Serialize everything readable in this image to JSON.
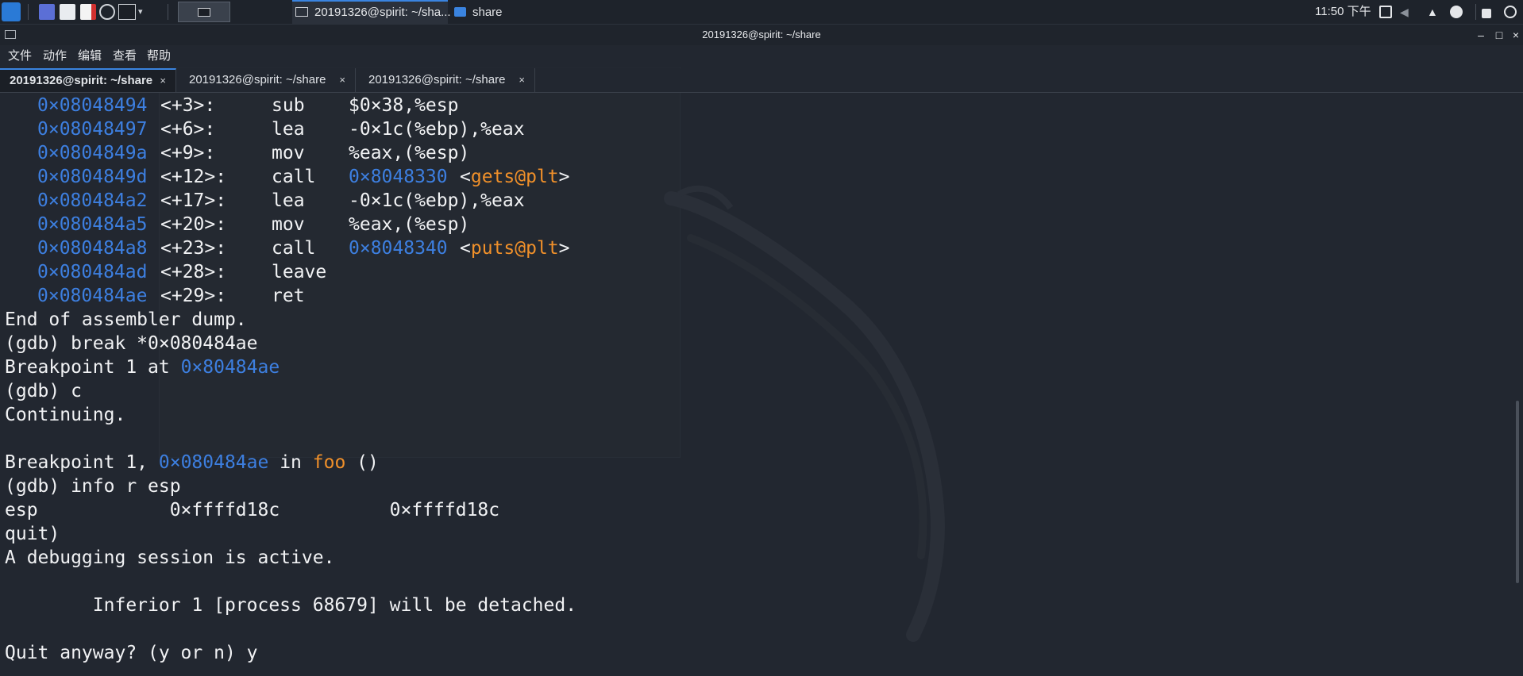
{
  "taskbar": {
    "task_terminal": "20191326@spirit: ~/sha...",
    "task_folder": "share",
    "clock": "11:50 下午"
  },
  "window": {
    "title": "20191326@spirit: ~/share",
    "btn_min": "–",
    "btn_max": "□",
    "btn_close": "×"
  },
  "menu": [
    "文件",
    "动作",
    "编辑",
    "查看",
    "帮助"
  ],
  "tabs": [
    {
      "label": "20191326@spirit: ~/share",
      "close": "×",
      "active": true
    },
    {
      "label": "20191326@spirit: ~/share",
      "close": "×",
      "active": false
    },
    {
      "label": "20191326@spirit: ~/share",
      "close": "×",
      "active": false
    }
  ],
  "terminal": {
    "asm": [
      {
        "addr": "0×08048494",
        "off": "<+3>:",
        "op": "sub",
        "args": "$0×38,%esp"
      },
      {
        "addr": "0×08048497",
        "off": "<+6>:",
        "op": "lea",
        "args": "-0×1c(%ebp),%eax"
      },
      {
        "addr": "0×0804849a",
        "off": "<+9>:",
        "op": "mov",
        "args": "%eax,(%esp)"
      },
      {
        "addr": "0×0804849d",
        "off": "<+12>:",
        "op": "call",
        "target": "0×8048330",
        "sym": "gets@plt"
      },
      {
        "addr": "0×080484a2",
        "off": "<+17>:",
        "op": "lea",
        "args": "-0×1c(%ebp),%eax"
      },
      {
        "addr": "0×080484a5",
        "off": "<+20>:",
        "op": "mov",
        "args": "%eax,(%esp)"
      },
      {
        "addr": "0×080484a8",
        "off": "<+23>:",
        "op": "call",
        "target": "0×8048340",
        "sym": "puts@plt"
      },
      {
        "addr": "0×080484ad",
        "off": "<+28>:",
        "op": "leave",
        "args": ""
      },
      {
        "addr": "0×080484ae",
        "off": "<+29>:",
        "op": "ret",
        "args": ""
      }
    ],
    "end_dump": "End of assembler dump.",
    "cmd_break": "(gdb) break *0×080484ae",
    "bp_set_text": "Breakpoint 1 at ",
    "bp_set_addr": "0×80484ae",
    "cmd_continue": "(gdb) c",
    "continuing": "Continuing.",
    "bp_hit_text": "Breakpoint 1, ",
    "bp_hit_addr": "0×080484ae",
    "bp_hit_in": " in ",
    "bp_hit_func": "foo",
    "bp_hit_tail": " ()",
    "cmd_info": "(gdb) info r esp",
    "reg_line": "esp            0×ffffd18c          0×ffffd18c",
    "quit_line": "quit)",
    "session_active": "A debugging session is active.",
    "inferior_line": "        Inferior 1 [process 68679] will be detached.",
    "quit_prompt": "Quit anyway? (y or n) y"
  }
}
